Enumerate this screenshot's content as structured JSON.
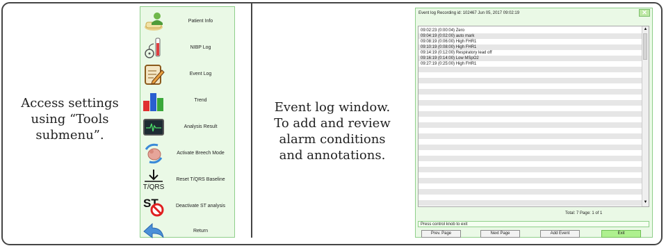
{
  "left_caption": {
    "lines": [
      "Access settings",
      "using “Tools",
      "submenu”."
    ]
  },
  "middle_caption": {
    "lines": [
      "Event log window.",
      "To add and review",
      "alarm conditions",
      "and annotations."
    ]
  },
  "tools_menu": {
    "items": [
      {
        "label": "Patient Info",
        "icon": "patient-info-icon"
      },
      {
        "label": "NIBP Log",
        "icon": "nibp-log-icon"
      },
      {
        "label": "Event Log",
        "icon": "event-log-icon"
      },
      {
        "label": "Trend",
        "icon": "trend-icon"
      },
      {
        "label": "Analysis Result",
        "icon": "analysis-result-icon"
      },
      {
        "label": "Activate Breech Mode",
        "icon": "breech-mode-icon"
      },
      {
        "label": "Reset T/QRS Baseline",
        "icon": "tqrs-baseline-icon",
        "icon_text": "T/QRS"
      },
      {
        "label": "Deactivate ST analysis",
        "icon": "st-analysis-icon",
        "icon_text": "ST"
      },
      {
        "label": "Return",
        "icon": "return-arrow-icon"
      }
    ]
  },
  "event_log": {
    "title": "Event log   Recording id: 102467  Jun 05, 2017 09:02:19",
    "close_label": "✕",
    "entries": [
      "09:02:23 (0:00:04) Zero",
      "09:04:19 (0:02:00) auto mark",
      "09:08:19 (0:06:00) High FHR1",
      "09:10:19 (0:08:00) High FHR1",
      "09:14:19 (0:12:00) Respiratory lead off",
      "09:16:19 (0:14:00) Low MSpO2",
      "09:27:19 (0:25:00) High FHR1"
    ],
    "total_text": "Total: 7  Page: 1 of 1",
    "status_text": "Press control knob to exit",
    "buttons": {
      "prev": "Prev. Page",
      "next": "Next Page",
      "add": "Add Event",
      "exit": "Exit"
    },
    "scroll_up": "▲",
    "scroll_down": "▼"
  },
  "colors": {
    "panel_bg": "#eaf9e6",
    "panel_border": "#8fcf8a",
    "exit_button": "#aef08f",
    "list_stripe": "#e6e6e6"
  }
}
